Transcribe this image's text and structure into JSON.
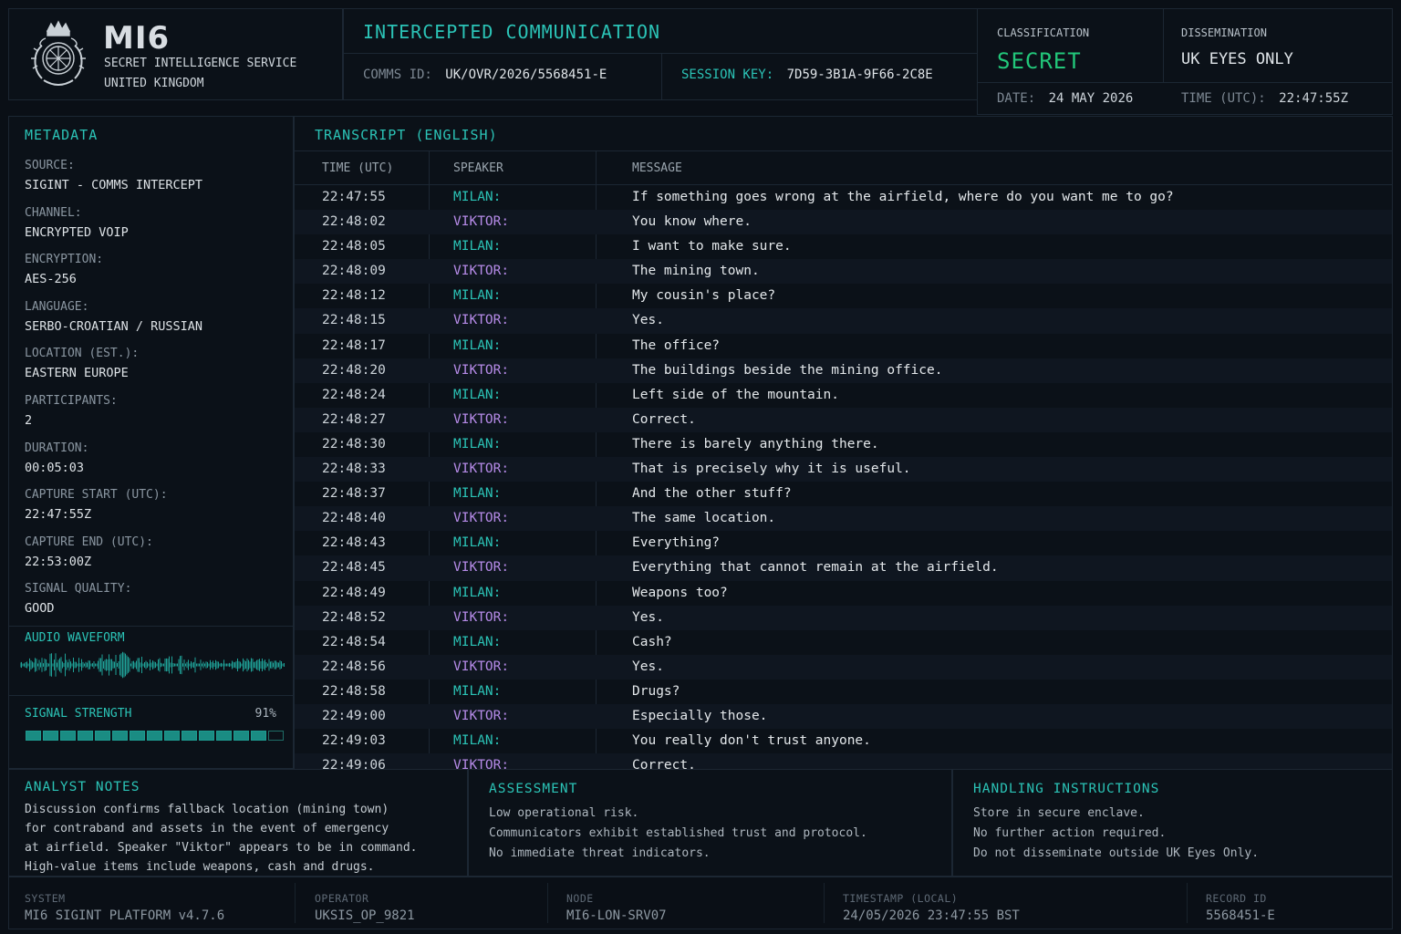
{
  "header": {
    "org_name": "MI6",
    "org_line1": "SECRET INTELLIGENCE SERVICE",
    "org_line2": "UNITED KINGDOM",
    "doc_title": "INTERCEPTED COMMUNICATION",
    "comms_id_label": "COMMS ID:",
    "comms_id": "UK/OVR/2026/5568451-E",
    "session_key_label": "SESSION KEY:",
    "session_key": "7D59-3B1A-9F66-2C8E",
    "classification_label": "CLASSIFICATION",
    "classification": "SECRET",
    "dissemination_label": "DISSEMINATION",
    "dissemination": "UK EYES ONLY",
    "date_label": "DATE:",
    "date": "24 MAY 2026",
    "time_label": "TIME (UTC):",
    "time": "22:47:55Z"
  },
  "metadata": {
    "title": "METADATA",
    "items": [
      {
        "label": "SOURCE:",
        "value": "SIGINT - COMMS INTERCEPT"
      },
      {
        "label": "CHANNEL:",
        "value": "ENCRYPTED VOIP"
      },
      {
        "label": "ENCRYPTION:",
        "value": "AES-256"
      },
      {
        "label": "LANGUAGE:",
        "value": "SERBO-CROATIAN / RUSSIAN"
      },
      {
        "label": "LOCATION (EST.):",
        "value": "EASTERN EUROPE"
      },
      {
        "label": "PARTICIPANTS:",
        "value": "2"
      },
      {
        "label": "DURATION:",
        "value": "00:05:03"
      },
      {
        "label": "CAPTURE START (UTC):",
        "value": "22:47:55Z"
      },
      {
        "label": "CAPTURE END (UTC):",
        "value": "22:53:00Z"
      },
      {
        "label": "SIGNAL QUALITY:",
        "value": "GOOD"
      }
    ],
    "waveform_title": "AUDIO WAVEFORM",
    "signal_title": "SIGNAL STRENGTH",
    "signal_pct": "91%",
    "signal_fraction": 0.91,
    "signal_segments_total": 15
  },
  "transcript": {
    "title": "TRANSCRIPT (ENGLISH)",
    "columns": [
      "TIME (UTC)",
      "SPEAKER",
      "MESSAGE"
    ],
    "rows": [
      {
        "time": "22:47:55",
        "speaker": "MILAN:",
        "message": "If something goes wrong at the airfield, where do you want me to go?"
      },
      {
        "time": "22:48:02",
        "speaker": "VIKTOR:",
        "message": "You know where."
      },
      {
        "time": "22:48:05",
        "speaker": "MILAN:",
        "message": "I want to make sure."
      },
      {
        "time": "22:48:09",
        "speaker": "VIKTOR:",
        "message": "The mining town."
      },
      {
        "time": "22:48:12",
        "speaker": "MILAN:",
        "message": "My cousin's place?"
      },
      {
        "time": "22:48:15",
        "speaker": "VIKTOR:",
        "message": "Yes."
      },
      {
        "time": "22:48:17",
        "speaker": "MILAN:",
        "message": "The office?"
      },
      {
        "time": "22:48:20",
        "speaker": "VIKTOR:",
        "message": "The buildings beside the mining office."
      },
      {
        "time": "22:48:24",
        "speaker": "MILAN:",
        "message": "Left side of the mountain."
      },
      {
        "time": "22:48:27",
        "speaker": "VIKTOR:",
        "message": "Correct."
      },
      {
        "time": "22:48:30",
        "speaker": "MILAN:",
        "message": "There is barely anything there."
      },
      {
        "time": "22:48:33",
        "speaker": "VIKTOR:",
        "message": "That is precisely why it is useful."
      },
      {
        "time": "22:48:37",
        "speaker": "MILAN:",
        "message": "And the other stuff?"
      },
      {
        "time": "22:48:40",
        "speaker": "VIKTOR:",
        "message": "The same location."
      },
      {
        "time": "22:48:43",
        "speaker": "MILAN:",
        "message": "Everything?"
      },
      {
        "time": "22:48:45",
        "speaker": "VIKTOR:",
        "message": "Everything that cannot remain at the airfield."
      },
      {
        "time": "22:48:49",
        "speaker": "MILAN:",
        "message": "Weapons too?"
      },
      {
        "time": "22:48:52",
        "speaker": "VIKTOR:",
        "message": "Yes."
      },
      {
        "time": "22:48:54",
        "speaker": "MILAN:",
        "message": "Cash?"
      },
      {
        "time": "22:48:56",
        "speaker": "VIKTOR:",
        "message": "Yes."
      },
      {
        "time": "22:48:58",
        "speaker": "MILAN:",
        "message": "Drugs?"
      },
      {
        "time": "22:49:00",
        "speaker": "VIKTOR:",
        "message": "Especially those."
      },
      {
        "time": "22:49:03",
        "speaker": "MILAN:",
        "message": "You really don't trust anyone."
      },
      {
        "time": "22:49:06",
        "speaker": "VIKTOR:",
        "message": "Correct."
      }
    ]
  },
  "analyst_notes": {
    "title": "ANALYST NOTES",
    "lines": [
      "Discussion confirms fallback location (mining town)",
      "for contraband and assets in the event of emergency",
      "at airfield. Speaker \"Viktor\" appears to be in command.",
      "High-value items include weapons, cash and drugs."
    ]
  },
  "assessment": {
    "title": "ASSESSMENT",
    "lines": [
      "Low operational risk.",
      "Communicators exhibit established trust and protocol.",
      "No immediate threat indicators."
    ]
  },
  "handling": {
    "title": "HANDLING INSTRUCTIONS",
    "lines": [
      "Store in secure enclave.",
      "No further action required.",
      "Do not disseminate outside UK Eyes Only."
    ]
  },
  "footer": {
    "system_label": "SYSTEM",
    "system": "MI6 SIGINT PLATFORM v4.7.6",
    "operator_label": "OPERATOR",
    "operator": "UKSIS_OP_9821",
    "node_label": "NODE",
    "node": "MI6-LON-SRV07",
    "timestamp_label": "TIMESTAMP (LOCAL)",
    "timestamp": "24/05/2026 23:47:55 BST",
    "record_label": "RECORD ID",
    "record": "5568451-E"
  },
  "colors": {
    "accent": "#2bc3b6",
    "classification": "#22c77a",
    "speaker_milan": "#2bc3b6",
    "speaker_viktor": "#b68be8",
    "background": "#0a0f16"
  }
}
